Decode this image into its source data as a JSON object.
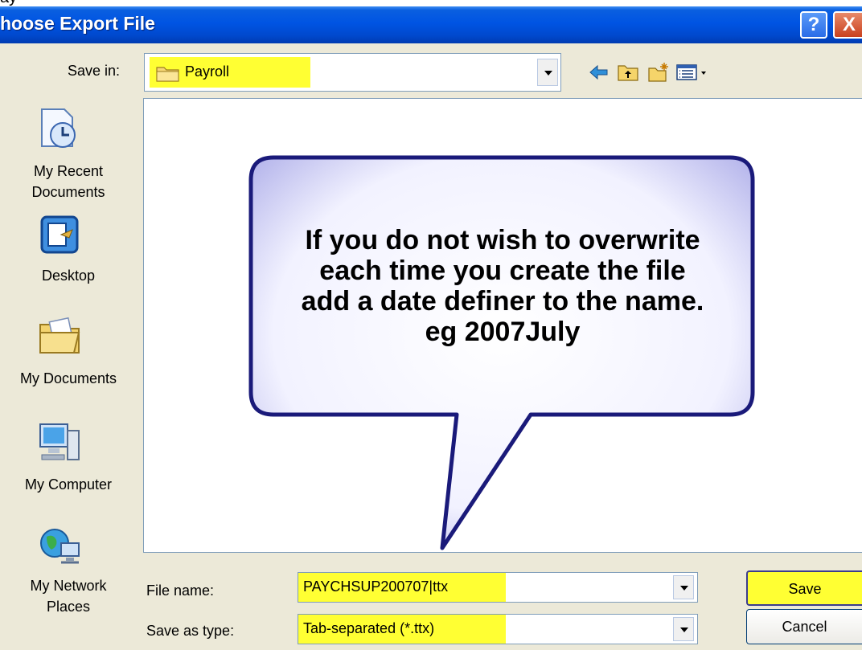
{
  "underlying_text": "ay",
  "window": {
    "title": "hoose Export File"
  },
  "title_buttons": {
    "help": "?",
    "close": "X"
  },
  "save_in": {
    "label": "Save in:",
    "value": "Payroll"
  },
  "places": [
    {
      "label": "My Recent\nDocuments",
      "icon": "recent-documents-icon"
    },
    {
      "label": "Desktop",
      "icon": "desktop-icon"
    },
    {
      "label": "My Documents",
      "icon": "my-documents-icon"
    },
    {
      "label": "My Computer",
      "icon": "my-computer-icon"
    },
    {
      "label": "My Network\nPlaces",
      "icon": "network-places-icon"
    }
  ],
  "callout": {
    "text_lines": [
      "If you do not wish to overwrite",
      "each time you create the file",
      "add a date definer to the name.",
      "eg 2007July"
    ]
  },
  "file_name": {
    "label": "File name:",
    "value": "PAYCHSUP200707|ttx"
  },
  "save_as_type": {
    "label": "Save as type:",
    "value": "Tab-separated (*.ttx)"
  },
  "buttons": {
    "save": "Save",
    "cancel": "Cancel"
  },
  "colors": {
    "highlight": "#ffff33",
    "titlebar": "#0054e3",
    "callout_fill": "#e4e4ff",
    "callout_stroke": "#1a1a7a"
  }
}
